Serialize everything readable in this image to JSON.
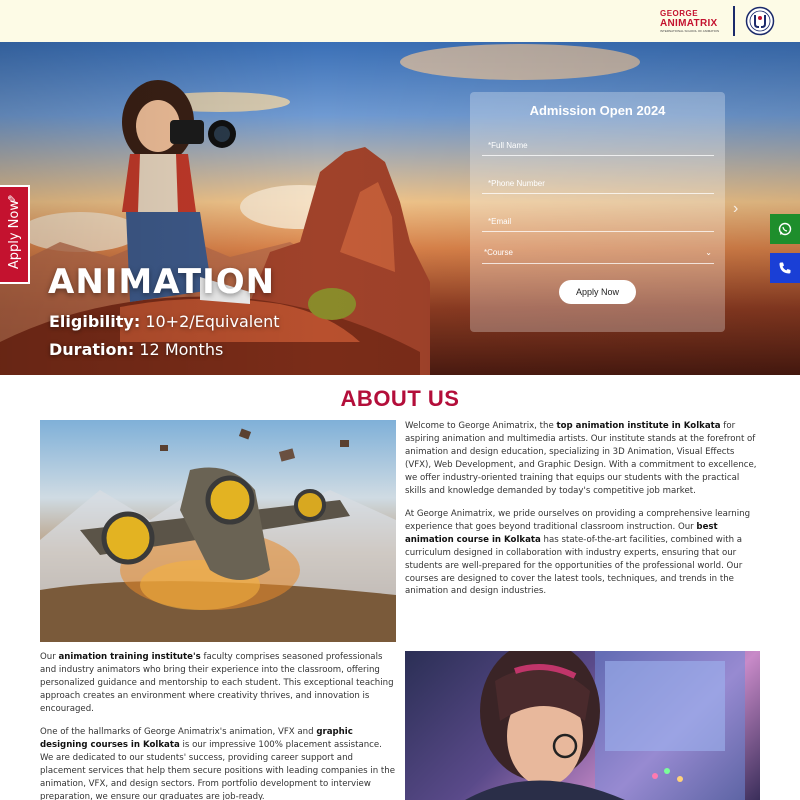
{
  "header": {
    "logo_george_line1": "GEORGE",
    "logo_george_line2": "ANIMATRIX",
    "logo_george_line3": "INTERNATIONAL SCHOOL OF ANIMATION"
  },
  "hero": {
    "title": "ANIMATION",
    "eligibility_label": "Eligibility:",
    "eligibility_value": "10+2/Equivalent",
    "duration_label": "Duration:",
    "duration_value": "12 Months",
    "apply_tab_label": "Apply Now",
    "next_arrow": "›"
  },
  "form": {
    "title": "Admission Open 2024",
    "full_name_placeholder": "*Full Name",
    "phone_placeholder": "*Phone Number",
    "email_placeholder": "*Email",
    "course_selected": "*Course",
    "submit_label": "Apply Now"
  },
  "floating": {
    "whatsapp_icon": "whatsapp-icon",
    "phone_icon": "phone-icon"
  },
  "about": {
    "title": "ABOUT US",
    "p1_a": "Welcome to George Animatrix, the ",
    "p1_b": "top animation institute in Kolkata",
    "p1_c": " for aspiring animation and multimedia artists. Our institute stands at the forefront of animation and design education, specializing in 3D Animation, Visual Effects (VFX), Web Development, and Graphic Design. With a commitment to excellence, we offer industry-oriented training that equips our students with the practical skills and knowledge demanded by today's competitive job market.",
    "p2_a": "At George Animatrix, we pride ourselves on providing a comprehensive learning experience that goes beyond traditional classroom instruction. Our ",
    "p2_b": "best animation course in Kolkata",
    "p2_c": " has state-of-the-art facilities, combined with a curriculum designed in collaboration with industry experts, ensuring that our students are well-prepared for the opportunities of the professional world. Our courses are designed to cover the latest tools, techniques, and trends in the animation and design industries.",
    "p3_a": "Our ",
    "p3_b": "animation training institute's",
    "p3_c": " faculty comprises seasoned professionals and industry animators who bring their experience into the classroom, offering personalized guidance and mentorship to each student. This exceptional teaching approach creates an environment where creativity thrives, and innovation is encouraged.",
    "p4_a": "One of the hallmarks of George Animatrix's animation, VFX and ",
    "p4_b": "graphic designing courses in Kolkata",
    "p4_c": " is our impressive 100% placement assistance. We are dedicated to our students' success, providing career support and placement services that help them secure positions with leading companies in the animation, VFX, and design sectors. From portfolio development to interview preparation, we ensure our graduates are job-ready."
  },
  "colors": {
    "brand_red": "#c4122f",
    "heading_red": "#b30e3a",
    "header_bg": "#fdfbe6",
    "whatsapp_green": "#1e8e2c",
    "phone_blue": "#1a3fd6"
  }
}
